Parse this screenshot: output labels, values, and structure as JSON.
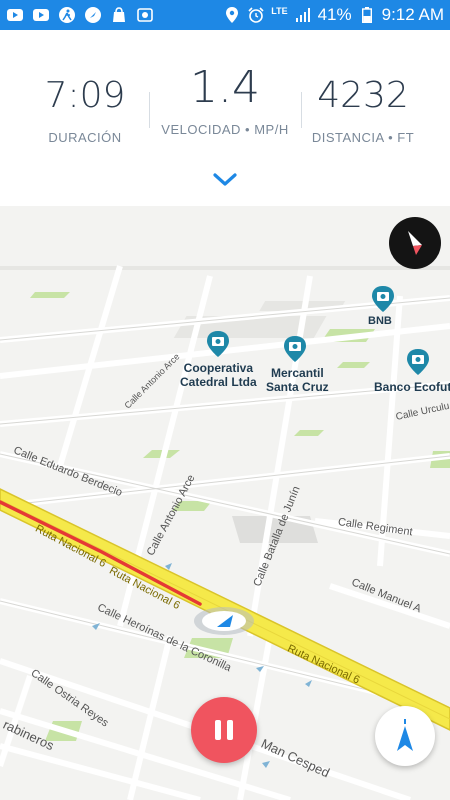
{
  "status_bar": {
    "network": "LTE",
    "battery": "41%",
    "time": "9:12 AM",
    "left_icons": [
      "youtube-icon",
      "youtube-icon",
      "fitness-icon",
      "compass-app-icon",
      "shopping-bag-icon",
      "photo-icon"
    ],
    "right_icons": [
      "location-icon",
      "alarm-icon",
      "signal-icon",
      "battery-icon"
    ]
  },
  "stats": {
    "duration": {
      "value": "7:09",
      "label": "DURACIÓN"
    },
    "speed": {
      "value": "1.4",
      "label": "VELOCIDAD • MP/H"
    },
    "distance": {
      "value": "4232",
      "label": "DISTANCIA • FT"
    }
  },
  "map": {
    "pois": [
      {
        "name": "BNB"
      },
      {
        "name": "Cooperativa\nCatedral Ltda"
      },
      {
        "name": "Mercantil\nSanta Cruz"
      },
      {
        "name": "Banco Ecofutu"
      }
    ],
    "streets": [
      "Calle Eduardo Berdecio",
      "Calle Antonio Arce",
      "Calle Batalla de Junín",
      "Calle Regiment",
      "Calle Manuel A",
      "Ruta Nacional 6",
      "Ruta Nacional 6",
      "Ruta Nacional 6",
      "Calle Heroínas de la Coronilla",
      "Calle Ostria Reyes",
      "rabineros",
      "Man Cesped",
      "Calle Antonio Arce",
      "Calle Urculu"
    ],
    "colors": {
      "highway": "#f5e94a",
      "highway_edge": "#d9c42a",
      "traffic": "#e53935",
      "park": "#c7e3a5",
      "accent": "#1e88e5"
    }
  },
  "controls": {
    "compass": "compass-icon",
    "pause": "pause-icon",
    "recenter": "navigation-arrow-icon",
    "expand": "chevron-down-icon"
  }
}
